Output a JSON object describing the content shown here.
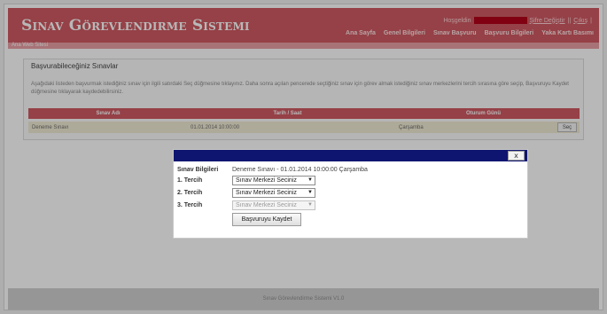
{
  "header": {
    "title": "Sınav Görevlendirme Sistemi",
    "greeting": "Hoşgeldin",
    "user_name": "",
    "links": [
      "Şifre Değiştir",
      "Çıkış"
    ]
  },
  "nav": {
    "items": [
      "Ana Sayfa",
      "Genel Bilgileri",
      "Sınav Başvuru",
      "Başvuru Bilgileri",
      "Yaka Kartı Basımı"
    ]
  },
  "subbar": {
    "text": "Ana Web Sitesi"
  },
  "content": {
    "section_title": "Başvurabileceğiniz Sınavlar",
    "description": "Aşağıdaki listeden başvurmak istediğiniz sınav için ilgili satırdaki Seç düğmesine tıklayınız. Daha sonra açılan pencerede seçtiğiniz sınav için görev almak istediğiniz sınav merkezlerini tercih sırasına göre seçip, Başvuruyu Kaydet düğmesine tıklayarak kaydedebilirsiniz.",
    "table": {
      "columns": [
        "Sınav Adı",
        "Tarih / Saat",
        "Oturum Günü"
      ],
      "rows": [
        {
          "name": "Deneme Sınavı",
          "datetime": "01.01.2014 10:00:00",
          "day": "Çarşamba",
          "action": "Seç"
        }
      ]
    }
  },
  "footer": {
    "text": "Sınav Görevlendirme Sistemi V1.0"
  },
  "dialog": {
    "close_label": "x",
    "info_label": "Sınav Bilgileri",
    "info_value": "Deneme Sınavı - 01.01.2014 10:00:00 Çarşamba",
    "preferences": [
      {
        "label": "1. Tercih",
        "selected": "Sınav Merkezi Seciniz",
        "disabled": false
      },
      {
        "label": "2. Tercih",
        "selected": "Sınav Merkezi Seciniz",
        "disabled": false
      },
      {
        "label": "3. Tercih",
        "selected": "Sınav Merkezi Seciniz",
        "disabled": true
      }
    ],
    "submit_label": "Başvuruyu Kaydet"
  },
  "colors": {
    "header_bg": "#cf5b63",
    "dialog_titlebar": "#0e1570",
    "row_bg": "#f1ecd5"
  }
}
